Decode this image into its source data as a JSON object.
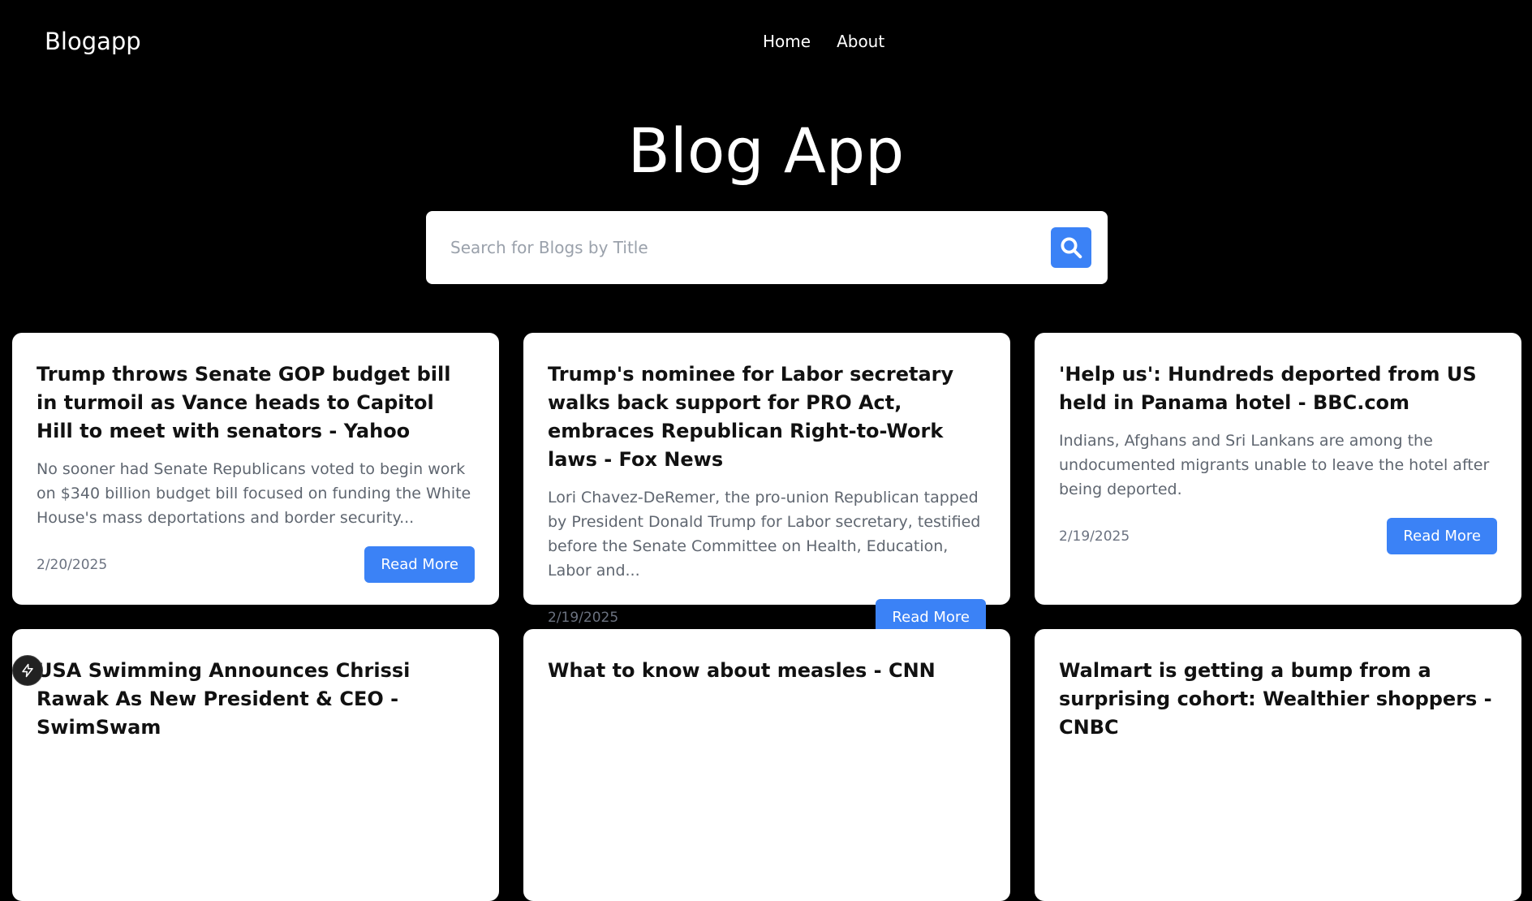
{
  "navbar": {
    "brand": "Blogapp",
    "links": [
      "Home",
      "About"
    ]
  },
  "hero": {
    "title": "Blog App"
  },
  "search": {
    "placeholder": "Search for Blogs by Title",
    "icon": "search-icon"
  },
  "posts": [
    {
      "title": "Trump throws Senate GOP budget bill in turmoil as Vance heads to Capitol Hill to meet with senators - Yahoo",
      "description": "No sooner had Senate Republicans voted to begin work on $340 billion budget bill focused on funding the White House's mass deportations and border security...",
      "date": "2/20/2025",
      "button": "Read More"
    },
    {
      "title": "Trump's nominee for Labor secretary walks back support for PRO Act, embraces Republican Right-to-Work laws - Fox News",
      "description": "Lori Chavez-DeRemer, the pro-union Republican tapped by President Donald Trump for Labor secretary, testified before the Senate Committee on Health, Education, Labor and...",
      "date": "2/19/2025",
      "button": "Read More"
    },
    {
      "title": "'Help us': Hundreds deported from US held in Panama hotel - BBC.com",
      "description": "Indians, Afghans and Sri Lankans are among the undocumented migrants unable to leave the hotel after being deported.",
      "date": "2/19/2025",
      "button": "Read More"
    },
    {
      "title": "USA Swimming Announces Chrissi Rawak As New President & CEO - SwimSwam",
      "description": "",
      "date": "",
      "button": ""
    },
    {
      "title": "What to know about measles - CNN",
      "description": "",
      "date": "",
      "button": ""
    },
    {
      "title": "Walmart is getting a bump from a surprising cohort: Wealthier shoppers - CNBC",
      "description": "",
      "date": "",
      "button": ""
    }
  ],
  "colors": {
    "background": "#000000",
    "accent": "#3b82f6",
    "card": "#ffffff"
  }
}
